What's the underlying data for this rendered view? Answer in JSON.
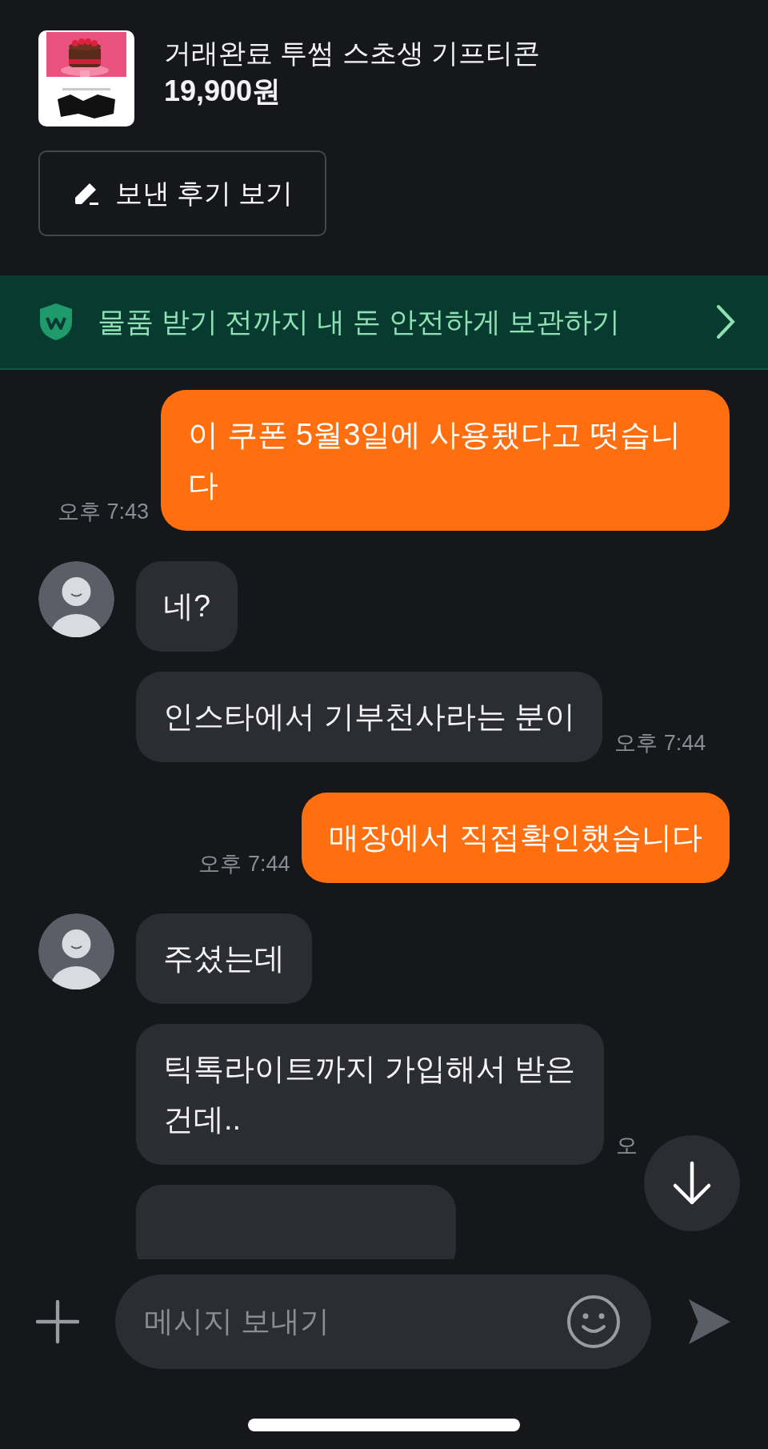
{
  "product": {
    "title": "거래완료 투썸 스초생 기프티콘",
    "price": "19,900원"
  },
  "review_button": {
    "label": "보낸 후기 보기"
  },
  "safe_pay_banner": {
    "text": "물품 받기 전까지 내 돈 안전하게 보관하기"
  },
  "messages": [
    {
      "kind": "sent",
      "text": "이 쿠폰 5월3일에 사용됐다고 떳습니다",
      "time": "오후 7:43"
    },
    {
      "kind": "received",
      "avatar": true,
      "text": "네?"
    },
    {
      "kind": "received",
      "avatar": false,
      "text": "인스타에서 기부천사라는 분이",
      "time": "오후 7:44"
    },
    {
      "kind": "sent",
      "text": "매장에서 직접확인했습니다",
      "time": "오후 7:44"
    },
    {
      "kind": "received",
      "avatar": true,
      "text": "주셨는데"
    },
    {
      "kind": "received",
      "avatar": false,
      "text": "틱톡라이트까지 가입해서 받은건데..",
      "time": "오"
    },
    {
      "kind": "received",
      "avatar": false
    }
  ],
  "composer": {
    "placeholder": "메시지 보내기"
  }
}
